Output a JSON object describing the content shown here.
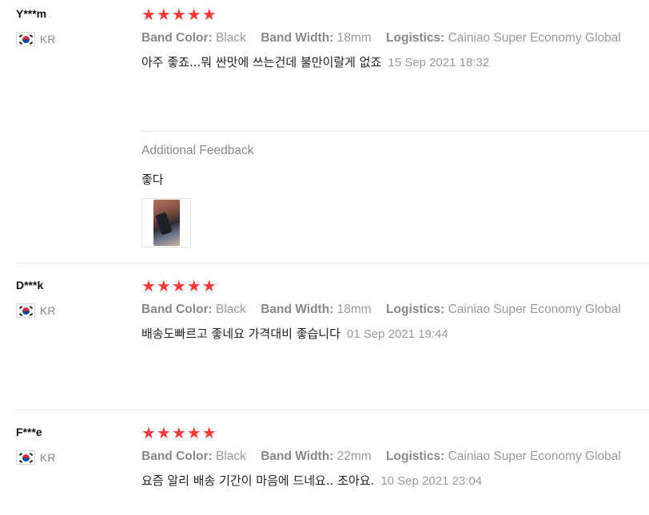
{
  "reviews": [
    {
      "user": "Y***m",
      "country": "KR",
      "stars": "★★★★★",
      "attrs": [
        {
          "key": "Band Color:",
          "value": "Black"
        },
        {
          "key": "Band Width:",
          "value": "18mm"
        },
        {
          "key": "Logistics:",
          "value": "Cainiao Super Economy Global"
        }
      ],
      "text": "아주 좋죠...뭐 싼맛에 쓰는건데 불만이랄게 없죠",
      "date": "15 Sep 2021 18:32",
      "additional": {
        "title": "Additional Feedback",
        "text": "좋다"
      }
    },
    {
      "user": "D***k",
      "country": "KR",
      "stars": "★★★★★",
      "attrs": [
        {
          "key": "Band Color:",
          "value": "Black"
        },
        {
          "key": "Band Width:",
          "value": "18mm"
        },
        {
          "key": "Logistics:",
          "value": "Cainiao Super Economy Global"
        }
      ],
      "text": "배송도빠르고 좋네요 가격대비 좋습니다",
      "date": "01 Sep 2021 19:44"
    },
    {
      "user": "F***e",
      "country": "KR",
      "stars": "★★★★★",
      "attrs": [
        {
          "key": "Band Color:",
          "value": "Black"
        },
        {
          "key": "Band Width:",
          "value": "22mm"
        },
        {
          "key": "Logistics:",
          "value": "Cainiao Super Economy Global"
        }
      ],
      "text": "요즘 알리 배송 기간이 마음에 드네요.. 조아요.",
      "date": "10 Sep 2021 23:04"
    }
  ],
  "colors": {
    "star": "#f23c3c",
    "muted_text": "#999999",
    "divider": "#e6e6e6"
  },
  "icons": {
    "flag": "south-korea-flag-icon",
    "star": "star-icon"
  }
}
